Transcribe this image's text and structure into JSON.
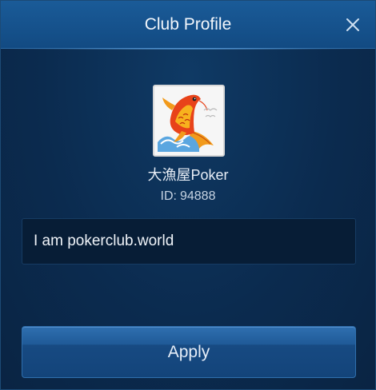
{
  "dialog": {
    "title": "Club Profile"
  },
  "club": {
    "name": "大漁屋Poker",
    "id_label": "ID:",
    "id_value": "94888",
    "description": "I am pokerclub.world",
    "avatar_icon": "koi-fish-icon"
  },
  "actions": {
    "apply_label": "Apply"
  },
  "colors": {
    "titlebar": "#1a5b98",
    "background": "#0b2b4f",
    "button": "#1f5a97"
  }
}
